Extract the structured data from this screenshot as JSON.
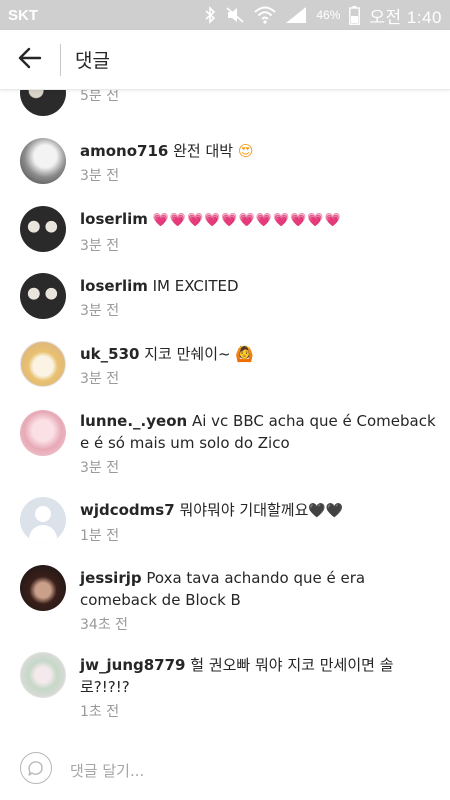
{
  "status_bar": {
    "carrier": "SKT",
    "battery": "46%",
    "clock": "오전 1:40",
    "icons": [
      "bluetooth-icon",
      "mute-icon",
      "wifi-icon",
      "signal-icon",
      "battery-icon"
    ]
  },
  "header": {
    "title": "댓글",
    "back_icon": "back-arrow-icon"
  },
  "comments": [
    {
      "username": "",
      "text": "",
      "time": "5분 전",
      "avatar": "dark"
    },
    {
      "username": "amono716",
      "text": " 완전 대박",
      "emoji": "😍",
      "time": "3분 전",
      "avatar": "gray"
    },
    {
      "username": "loserlim",
      "text": " ",
      "emoji": "💗💗💗💗💗💗💗💗💗💗💗",
      "time": "3분 전",
      "avatar": "duo"
    },
    {
      "username": "loserlim",
      "text": " IM EXCITED",
      "time": "3분 전",
      "avatar": "duo"
    },
    {
      "username": "uk_530",
      "text": " 지코 만쉐이~ ",
      "emoji": "🙆",
      "time": "3분 전",
      "avatar": "drawing"
    },
    {
      "username": "lunne._.yeon",
      "text": " Ai vc BBC acha que é Comeback e é só mais um solo do Zico",
      "time": "3분 전",
      "avatar": "pink"
    },
    {
      "username": "wjdcodms7",
      "text": " 뭐야뭐야 기대할께요",
      "emoji": "🖤🖤",
      "time": "1분 전",
      "avatar": "default"
    },
    {
      "username": "jessirjp",
      "text": " Poxa tava  achando que é era comeback de Block B",
      "time": "34초 전",
      "avatar": "night"
    },
    {
      "username": "jw_jung8779",
      "text": " 헐 권오빠 뭐야 지코 만세이면 솔로?!?!?",
      "time": "1초 전",
      "avatar": "flowers"
    }
  ],
  "composer": {
    "placeholder": "댓글 달기...",
    "icon": "comment-bubble-icon"
  },
  "colors": {
    "status_bar": "#cfcfcf",
    "text": "#262626",
    "secondary": "#9a9a9a"
  }
}
